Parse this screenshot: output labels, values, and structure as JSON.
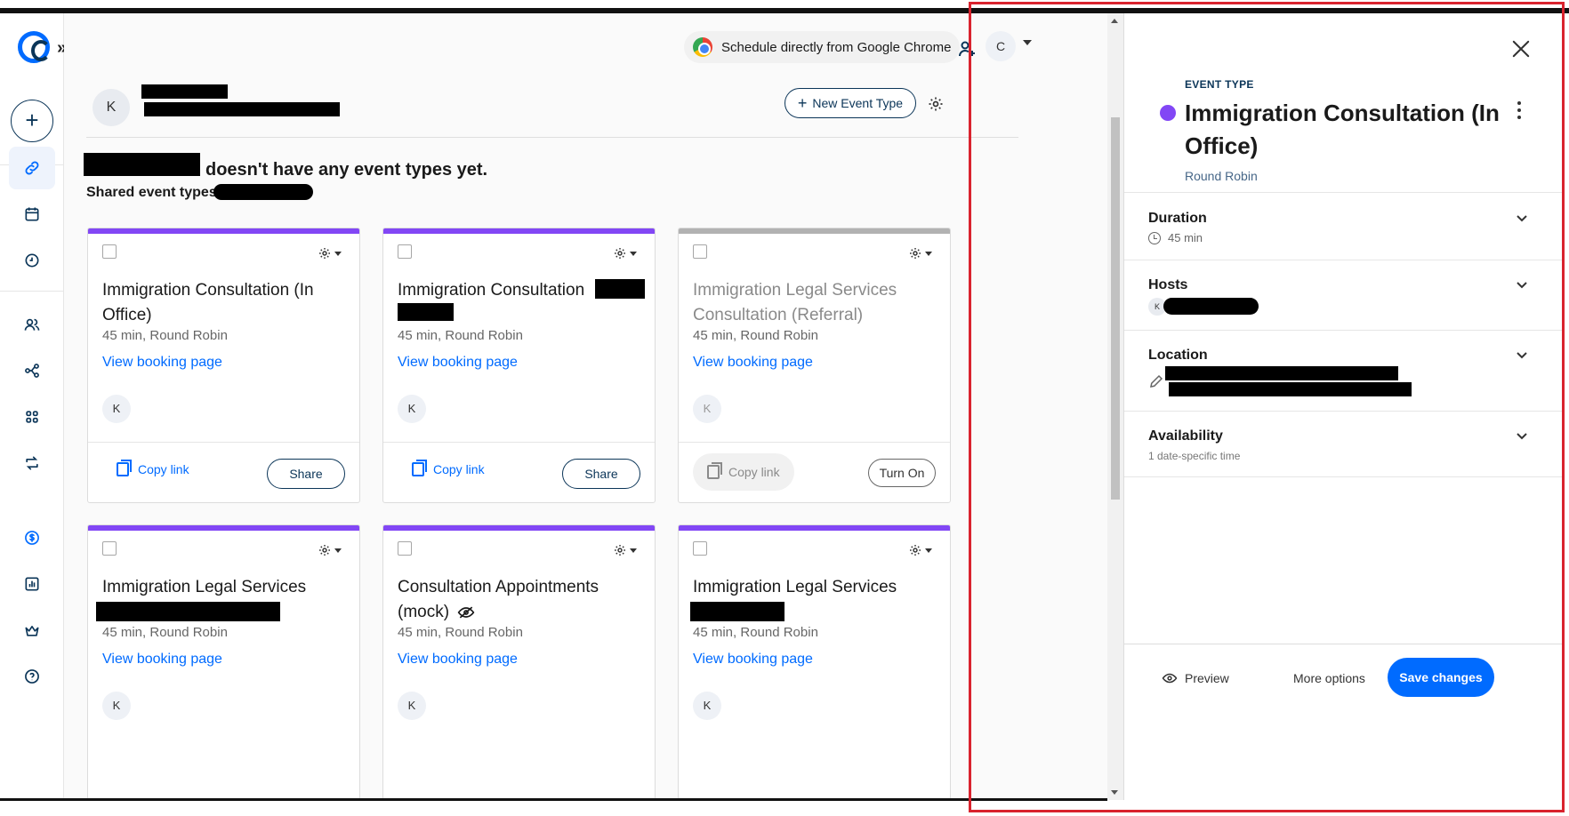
{
  "nav": {
    "create_icon": "plus-icon",
    "items": [
      {
        "name": "scheduling",
        "icon": "link-icon",
        "active": true
      },
      {
        "name": "meetings",
        "icon": "calendar-icon"
      },
      {
        "name": "availability",
        "icon": "clock-icon"
      },
      {
        "name": "contacts",
        "icon": "people-icon"
      },
      {
        "name": "workflows",
        "icon": "workflow-icon"
      },
      {
        "name": "integrations",
        "icon": "apps-icon"
      },
      {
        "name": "routing",
        "icon": "routing-icon"
      },
      {
        "name": "upgrade",
        "icon": "dollar-icon"
      },
      {
        "name": "analytics",
        "icon": "chart-icon"
      },
      {
        "name": "admin",
        "icon": "crown-icon"
      },
      {
        "name": "help",
        "icon": "help-icon"
      }
    ]
  },
  "header": {
    "chrome_prompt": "Schedule directly from Google Chrome",
    "user_initial": "C"
  },
  "owner": {
    "avatar_initial": "K"
  },
  "toolbar": {
    "new_event_type_label": "New Event Type"
  },
  "content": {
    "empty_message": "doesn't have any event types yet.",
    "shared_label": "Shared event types"
  },
  "cards": [
    {
      "title": "Immigration Consultation (In Office)",
      "meta": "45 min, Round Robin",
      "link": "View booking page",
      "avatar": "K",
      "copy": "Copy link",
      "action": "Share",
      "enabled": true
    },
    {
      "title": "Immigration Consultation",
      "meta": "45 min, Round Robin",
      "link": "View booking page",
      "avatar": "K",
      "copy": "Copy link",
      "action": "Share",
      "enabled": true
    },
    {
      "title": "Immigration Legal Services Consultation (Referral)",
      "meta": "45 min, Round Robin",
      "link": "View booking page",
      "avatar": "K",
      "copy": "Copy link",
      "action": "Turn On",
      "enabled": false
    },
    {
      "title": "Immigration Legal Services",
      "meta": "45 min, Round Robin",
      "link": "View booking page",
      "avatar": "K"
    },
    {
      "title": "Consultation Appointments (mock)",
      "meta": "45 min, Round Robin",
      "link": "View booking page",
      "avatar": "K",
      "hidden_icon": "eye-slash-icon"
    },
    {
      "title": "Immigration Legal Services",
      "meta": "45 min, Round Robin",
      "link": "View booking page",
      "avatar": "K"
    }
  ],
  "panel": {
    "kicker": "EVENT TYPE",
    "title": "Immigration Consultation (In Office)",
    "subtitle": "Round Robin",
    "accent": "#8247f5",
    "sections": {
      "duration": {
        "title": "Duration",
        "value": "45 min"
      },
      "hosts": {
        "title": "Hosts",
        "avatar": "K"
      },
      "location": {
        "title": "Location"
      },
      "availability": {
        "title": "Availability",
        "value": "1 date-specific time"
      }
    },
    "footer": {
      "preview": "Preview",
      "more_options": "More options",
      "save": "Save changes"
    }
  },
  "colors": {
    "brand_blue": "#006bff",
    "navy": "#0b3558",
    "purple": "#8247f5",
    "highlight_outline": "#d9232e"
  }
}
